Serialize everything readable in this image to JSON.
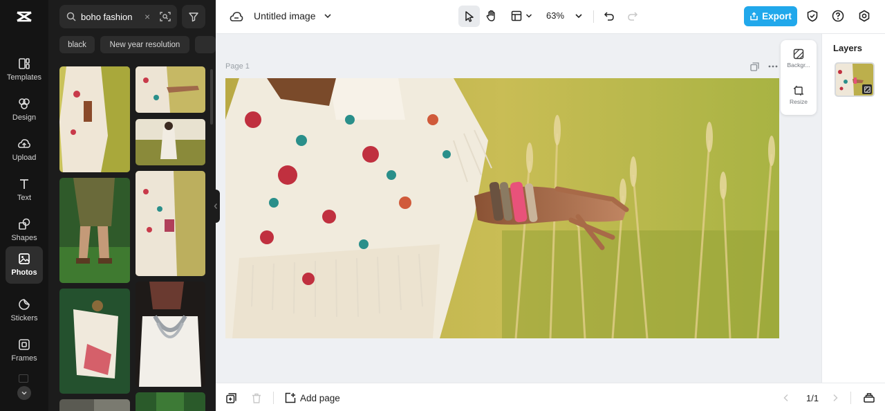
{
  "rail": {
    "items": [
      {
        "label": "Templates",
        "icon": "templates-icon"
      },
      {
        "label": "Design",
        "icon": "design-icon"
      },
      {
        "label": "Upload",
        "icon": "upload-icon"
      },
      {
        "label": "Text",
        "icon": "text-icon"
      },
      {
        "label": "Shapes",
        "icon": "shapes-icon"
      },
      {
        "label": "Photos",
        "icon": "photos-icon",
        "active": true
      },
      {
        "label": "Stickers",
        "icon": "stickers-icon"
      },
      {
        "label": "Frames",
        "icon": "frames-icon"
      }
    ]
  },
  "panel": {
    "search_value": "boho fashion",
    "chips": [
      "black",
      "New year resolution"
    ]
  },
  "topbar": {
    "title": "Untitled image",
    "zoom": "63%",
    "export_label": "Export"
  },
  "canvas": {
    "page_label": "Page 1"
  },
  "float_tools": {
    "background_label": "Backgr...",
    "resize_label": "Resize"
  },
  "layers": {
    "title": "Layers"
  },
  "bottombar": {
    "add_page_label": "Add page",
    "page_indicator": "1/1"
  },
  "colors": {
    "accent": "#21a8eb",
    "rail_bg": "#141414",
    "panel_bg": "#1c1c1c",
    "canvas_bg": "#eef0f3"
  }
}
